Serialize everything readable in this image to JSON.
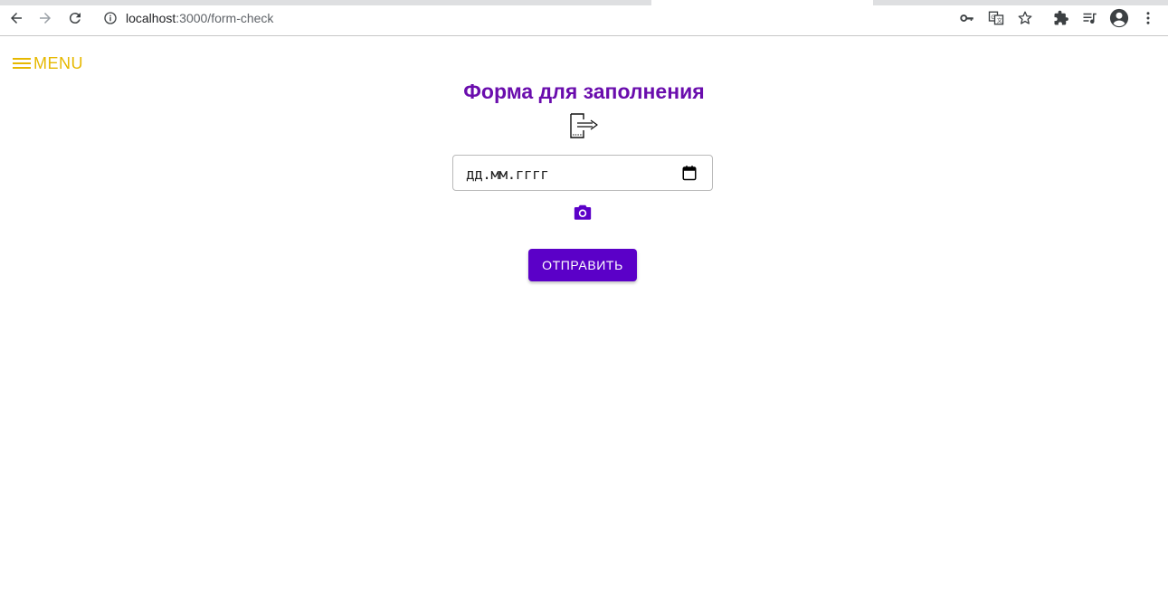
{
  "browser": {
    "url_host": "localhost",
    "url_path": ":3000/form-check"
  },
  "page": {
    "menu_label": "MENU",
    "title": "Форма для заполнения",
    "date_field": {
      "value": "дд.мм.гггг"
    },
    "submit_label": "ОТПРАВИТЬ"
  },
  "colors": {
    "accent": "#6a0dad",
    "button": "#5b00c8",
    "menu": "#e6b800"
  },
  "icons": [
    "back-icon",
    "forward-icon",
    "reload-icon",
    "info-icon",
    "key-icon",
    "translate-icon",
    "star-icon",
    "extensions-icon",
    "media-icon",
    "profile-icon",
    "kebab-menu-icon",
    "hamburger-icon",
    "file-export-icon",
    "calendar-icon",
    "camera-icon"
  ]
}
